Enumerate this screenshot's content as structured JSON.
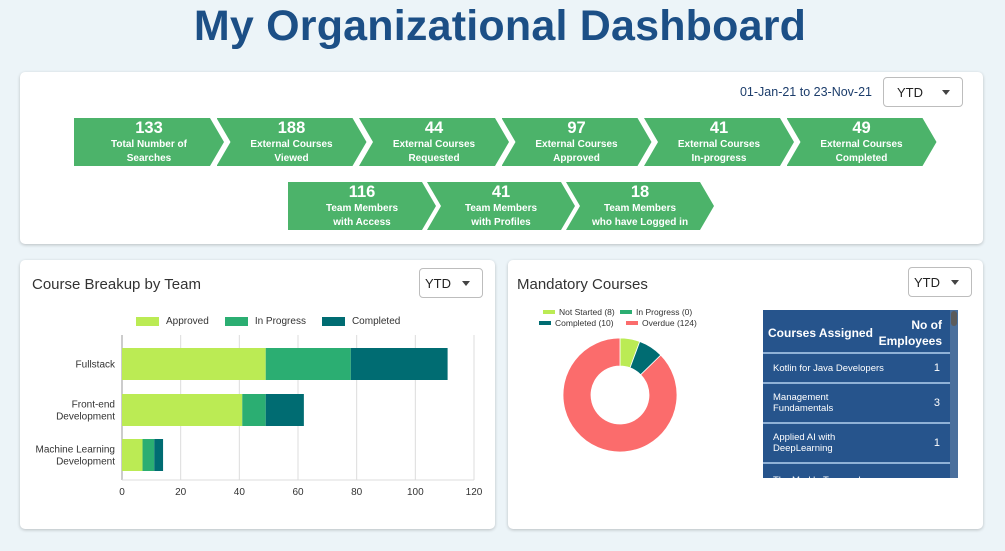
{
  "header": {
    "title": "My Organizational Dashboard"
  },
  "kpi": {
    "date_range": "01-Jan-21 to 23-Nov-21",
    "period_select": "YTD",
    "row1": [
      {
        "value": "133",
        "line1": "Total Number of",
        "line2": "Searches"
      },
      {
        "value": "188",
        "line1": "External Courses",
        "line2": "Viewed"
      },
      {
        "value": "44",
        "line1": "External Courses",
        "line2": "Requested"
      },
      {
        "value": "97",
        "line1": "External Courses",
        "line2": "Approved"
      },
      {
        "value": "41",
        "line1": "External Courses",
        "line2": "In-progress"
      },
      {
        "value": "49",
        "line1": "External Courses",
        "line2": "Completed"
      }
    ],
    "row2": [
      {
        "value": "116",
        "line1": "Team Members",
        "line2": "with Access"
      },
      {
        "value": "41",
        "line1": "Team Members",
        "line2": "with Profiles"
      },
      {
        "value": "18",
        "line1": "Team Members",
        "line2": "who have Logged in"
      }
    ],
    "chevron_color": "#4cb36a"
  },
  "team_panel": {
    "title": "Course Breakup by Team",
    "period_select": "YTD"
  },
  "mandatory_panel": {
    "title": "Mandatory Courses",
    "period_select": "YTD",
    "table": {
      "headers": [
        "Courses Assigned",
        "No of",
        "Employees"
      ],
      "rows": [
        {
          "course": "Kotlin for Java Developers",
          "count": "1"
        },
        {
          "course": "Management Fundamentals",
          "count": "3"
        },
        {
          "course": "Applied AI with DeepLearning",
          "count": "1"
        },
        {
          "course": "The Merkle Tree and",
          "count": ""
        }
      ]
    }
  },
  "chart_data": [
    {
      "type": "bar",
      "orientation": "horizontal",
      "stacked": true,
      "title": "Course Breakup by Team",
      "categories": [
        "Fullstack",
        "Front-end Development",
        "Machine Learning Development"
      ],
      "category_lines": [
        [
          "Fullstack"
        ],
        [
          "Front-end",
          "Development"
        ],
        [
          "Machine Learning",
          "Development"
        ]
      ],
      "series": [
        {
          "name": "Approved",
          "color": "#bbeb54",
          "values": [
            49,
            41,
            7
          ]
        },
        {
          "name": "In Progress",
          "color": "#2bae72",
          "values": [
            29,
            8,
            4
          ]
        },
        {
          "name": "Completed",
          "color": "#006c72",
          "values": [
            33,
            13,
            3
          ]
        }
      ],
      "xlim": [
        0,
        120
      ],
      "xticks": [
        0,
        20,
        40,
        60,
        80,
        100,
        120
      ],
      "grid": true,
      "legend": "top-center",
      "xlabel": "",
      "ylabel": ""
    },
    {
      "type": "pie",
      "donut": true,
      "title": "Mandatory Courses",
      "labels": [
        "Not Started (8)",
        "In Progress (0)",
        "Completed (10)",
        "Overdue (124)"
      ],
      "names": [
        "Not Started",
        "In Progress",
        "Completed",
        "Overdue"
      ],
      "values": [
        8,
        0,
        10,
        124
      ],
      "colors": [
        "#bbeb54",
        "#2bae72",
        "#006c72",
        "#fb6c6c"
      ],
      "legend": "top"
    }
  ]
}
